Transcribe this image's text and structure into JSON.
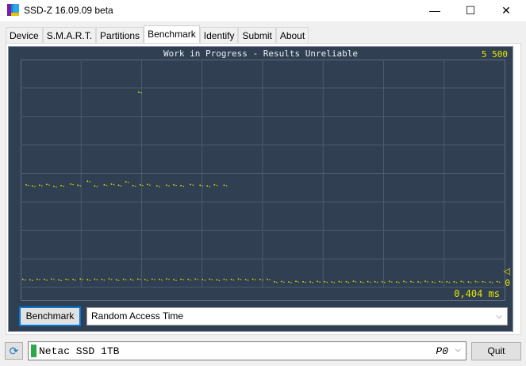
{
  "window": {
    "title": "SSD-Z 16.09.09 beta",
    "minimize": "—",
    "maximize": "☐",
    "close": "✕"
  },
  "tabs": [
    {
      "label": "Device"
    },
    {
      "label": "S.M.A.R.T."
    },
    {
      "label": "Partitions"
    },
    {
      "label": "Benchmark",
      "active": true
    },
    {
      "label": "Identify"
    },
    {
      "label": "Submit"
    },
    {
      "label": "About"
    }
  ],
  "chart_data": {
    "type": "scatter",
    "title": "Work in Progress - Results Unreliable",
    "ymax_label": "5 500",
    "ymin_label": "0",
    "marker": "◁",
    "xlabel": "0,404 ms",
    "ylim": [
      0,
      5500
    ],
    "xlim": [
      0,
      100
    ],
    "grid": true,
    "colors": {
      "background": "#304052",
      "grid": "#4b5b6d",
      "points": "#e6f000"
    },
    "series": [
      {
        "x": [
          0,
          1.5,
          3,
          4.5,
          6,
          7.5,
          9,
          10.5,
          12,
          13.5,
          15,
          16.5,
          18,
          19.5,
          21,
          22.5,
          24,
          25.5,
          27,
          28.5,
          30,
          31.5,
          33,
          34.5,
          36,
          37.5,
          39,
          40.5,
          42,
          43.5,
          45,
          46.5,
          48,
          49.5,
          51,
          52.5,
          54,
          55.5,
          57,
          58.5,
          60,
          61.5,
          63,
          64.5,
          66,
          67.5,
          69,
          70.5,
          72,
          73.5,
          75,
          76.5,
          78,
          79.5,
          81,
          82.5,
          84,
          85.5,
          87,
          88.5,
          90,
          91.5,
          93,
          94.5,
          96,
          97.5,
          99
        ],
        "y": [
          80,
          70,
          88,
          75,
          92,
          68,
          84,
          77,
          90,
          72,
          86,
          79,
          94,
          71,
          83,
          76,
          89,
          73,
          87,
          80,
          95,
          70,
          85,
          78,
          91,
          74,
          88,
          69,
          82,
          77,
          90,
          73,
          86,
          79,
          84,
          18,
          25,
          12,
          30,
          20,
          15,
          28,
          22,
          10,
          26,
          19,
          32,
          14,
          24,
          21,
          17,
          29,
          13,
          27,
          23,
          16,
          31,
          11,
          25,
          20,
          18,
          28,
          15,
          26,
          22,
          12,
          24
        ]
      },
      {
        "x": [
          0.7,
          2,
          3.5,
          5,
          6.5,
          8,
          10,
          11.5,
          13.5,
          15,
          17,
          18.5,
          20,
          21.5,
          23,
          24.5,
          26,
          28,
          30,
          31.5,
          33,
          35,
          37,
          38.5,
          40,
          42
        ],
        "y": [
          2600,
          2570,
          2590,
          2610,
          2560,
          2580,
          2620,
          2590,
          2700,
          2570,
          2600,
          2620,
          2590,
          2680,
          2580,
          2600,
          2610,
          2570,
          2590,
          2600,
          2580,
          2610,
          2590,
          2570,
          2600,
          2590
        ]
      },
      {
        "x": [
          24.2
        ],
        "y": [
          5070
        ]
      }
    ]
  },
  "controls": {
    "benchmark_button": "Benchmark",
    "test_select": "Random Access Time",
    "chevron": "⌵"
  },
  "status": {
    "refresh": "⟳",
    "device": "Netac SSD 1TB",
    "port": "P0",
    "chevron": "⌵",
    "quit": "Quit",
    "device_color": "#2aa84a"
  }
}
